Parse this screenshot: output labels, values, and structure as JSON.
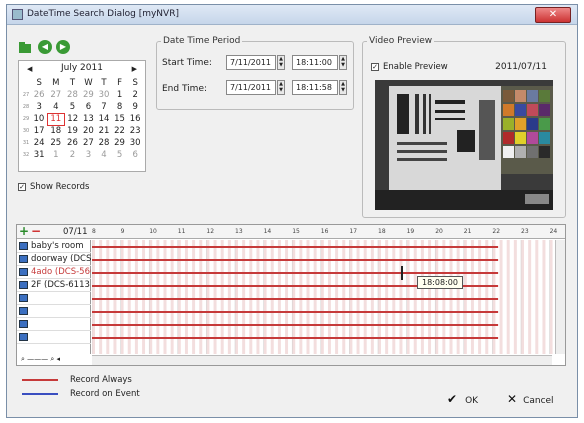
{
  "window": {
    "title": "DateTime Search Dialog [myNVR]",
    "close_label": "✕"
  },
  "calendar": {
    "month_label": "July 2011",
    "weekdays": [
      "S",
      "M",
      "T",
      "W",
      "T",
      "F",
      "S"
    ],
    "weeks": [
      {
        "wk": "27",
        "days": [
          "26",
          "27",
          "28",
          "29",
          "30",
          "1",
          "2"
        ]
      },
      {
        "wk": "28",
        "days": [
          "3",
          "4",
          "5",
          "6",
          "7",
          "8",
          "9"
        ]
      },
      {
        "wk": "29",
        "days": [
          "10",
          "11",
          "12",
          "13",
          "14",
          "15",
          "16"
        ]
      },
      {
        "wk": "30",
        "days": [
          "17",
          "18",
          "19",
          "20",
          "21",
          "22",
          "23"
        ]
      },
      {
        "wk": "31",
        "days": [
          "24",
          "25",
          "26",
          "27",
          "28",
          "29",
          "30"
        ]
      },
      {
        "wk": "32",
        "days": [
          "31",
          "1",
          "2",
          "3",
          "4",
          "5",
          "6"
        ]
      }
    ],
    "selected_day": "11"
  },
  "show_records": {
    "label": "Show Records",
    "checked": true
  },
  "date_time_period": {
    "legend": "Date Time Period",
    "start_label": "Start Time:",
    "start_date": "7/11/2011",
    "start_time": "18:11:00",
    "end_label": "End Time:",
    "end_date": "7/11/2011",
    "end_time": "18:11:58"
  },
  "video_preview": {
    "legend": "Video Preview",
    "enable_label": "Enable Preview",
    "enabled": true,
    "date": "2011/07/11"
  },
  "timeline": {
    "date": "07/11",
    "hours": [
      "8",
      "9",
      "10",
      "11",
      "12",
      "13",
      "14",
      "15",
      "16",
      "17",
      "18",
      "19",
      "20",
      "21",
      "22",
      "23",
      "24"
    ],
    "cameras": [
      "baby's room",
      "doorway (DCS",
      "4ado (DCS-566",
      "2F (DCS-6113",
      "",
      "",
      "",
      ""
    ],
    "cursor_time": "18:08:00"
  },
  "legend": {
    "always": "Record Always",
    "event": "Record on Event"
  },
  "colors": {
    "always": "#c63a3a",
    "event": "#3a4ec0"
  },
  "buttons": {
    "ok": "OK",
    "cancel": "Cancel"
  }
}
